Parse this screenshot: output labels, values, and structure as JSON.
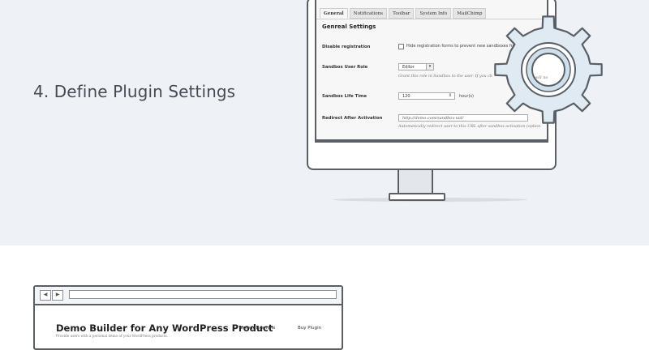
{
  "step": {
    "heading": "4. Define Plugin Settings"
  },
  "settings_panel": {
    "tabs": [
      "General",
      "Notifications",
      "Toolbar",
      "System Info",
      "MailChimp"
    ],
    "active_tab": "General",
    "section_title": "Genreal Settings",
    "rows": {
      "disable_registration": {
        "label": "Disable registration",
        "checkbox_text": "Hide registration forms to prevent new sandboxes fro",
        "checked": false
      },
      "sandbox_user_role": {
        "label": "Sandbox User Role",
        "value": "Editor",
        "hint": "Grant this role in Sandbox to the user. If you ch",
        "hint_tail": "will no"
      },
      "sandbox_life_time": {
        "label": "Sandbox Life Time",
        "value": "120",
        "unit": "hour(s)"
      },
      "redirect_after_activation": {
        "label": "Redirect After Activation",
        "value": "http://demo.com/sandbox-uid/",
        "hint": "Automatically redirect user to this URL after sandbox activation (option"
      }
    }
  },
  "gear": {
    "icon": "gear-icon",
    "fill": "#dfeaf2",
    "stroke": "#5a5f66"
  },
  "browser": {
    "back_icon": "◀",
    "forward_icon": "▶",
    "site_title": "Demo Builder for Any WordPress Product",
    "site_subtitle": "Provide users with a personal demo of your WordPress products.",
    "nav": [
      "Toolbar Example",
      "Buy Plugin"
    ]
  },
  "colors": {
    "band": "#eef2f6",
    "outline": "#5a5f66",
    "heading": "#444b57"
  }
}
